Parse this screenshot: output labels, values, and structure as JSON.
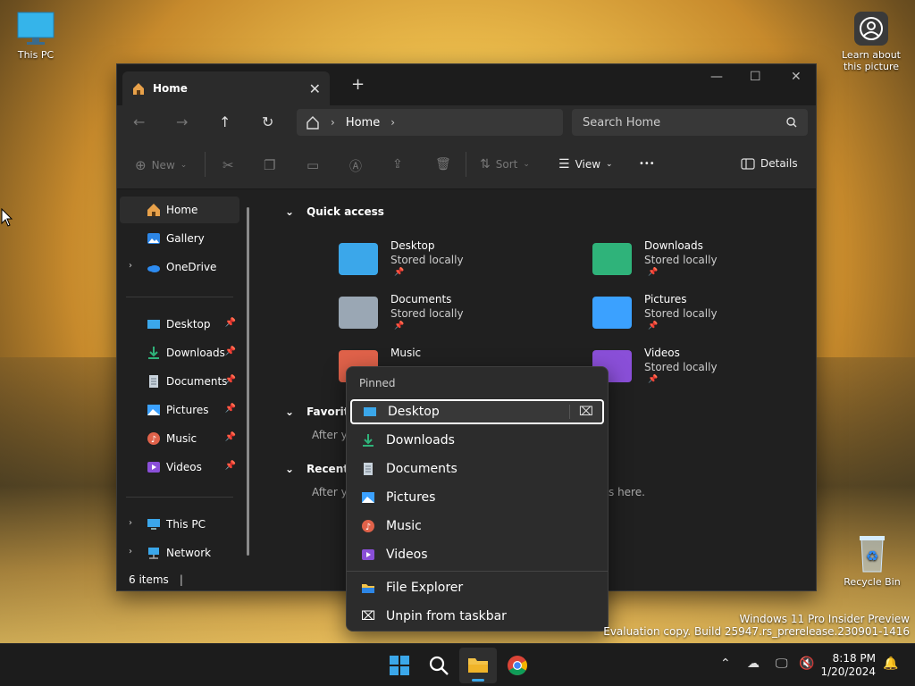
{
  "desktop": {
    "this_pc_label": "This PC",
    "learn_label_1": "Learn about",
    "learn_label_2": "this picture",
    "recycle_label": "Recycle Bin",
    "watermark_line1": "Windows 11 Pro Insider Preview",
    "watermark_line2": "Evaluation copy. Build 25947.rs_prerelease.230901-1416"
  },
  "window": {
    "tab_title": "Home",
    "new_tab": "+",
    "close_tab": "✕",
    "minimize": "—",
    "maximize": "☐",
    "close": "✕"
  },
  "nav": {
    "breadcrumb": "Home",
    "search_placeholder": "Search Home"
  },
  "commands": {
    "new": "New",
    "sort": "Sort",
    "view": "View",
    "more": "•••",
    "details": "Details"
  },
  "sidebar": {
    "items": [
      {
        "label": "Home"
      },
      {
        "label": "Gallery"
      },
      {
        "label": "OneDrive"
      },
      {
        "label": "Desktop"
      },
      {
        "label": "Downloads"
      },
      {
        "label": "Documents"
      },
      {
        "label": "Pictures"
      },
      {
        "label": "Music"
      },
      {
        "label": "Videos"
      },
      {
        "label": "This PC"
      },
      {
        "label": "Network"
      }
    ]
  },
  "content": {
    "quick_access": "Quick access",
    "favorites": "Favorite",
    "favorites_empty": "After yo",
    "recent": "Recent",
    "recent_empty": "After yo",
    "recent_empty_tail": "s here.",
    "stored": "Stored locally",
    "folders": [
      {
        "name": "Desktop"
      },
      {
        "name": "Downloads"
      },
      {
        "name": "Documents"
      },
      {
        "name": "Pictures"
      },
      {
        "name": "Music"
      },
      {
        "name": "Videos"
      }
    ]
  },
  "status": {
    "count": "6 items"
  },
  "menu": {
    "header": "Pinned",
    "items": [
      {
        "label": "Desktop"
      },
      {
        "label": "Downloads"
      },
      {
        "label": "Documents"
      },
      {
        "label": "Pictures"
      },
      {
        "label": "Music"
      },
      {
        "label": "Videos"
      }
    ],
    "file_explorer": "File Explorer",
    "unpin": "Unpin from taskbar"
  },
  "taskbar": {
    "time": "8:18 PM",
    "date": "1/20/2024"
  },
  "colors": {
    "accent": "#3ba1ff",
    "downloads": "#2fb37a",
    "music": "#e0624a",
    "videos": "#8a4fd8"
  }
}
